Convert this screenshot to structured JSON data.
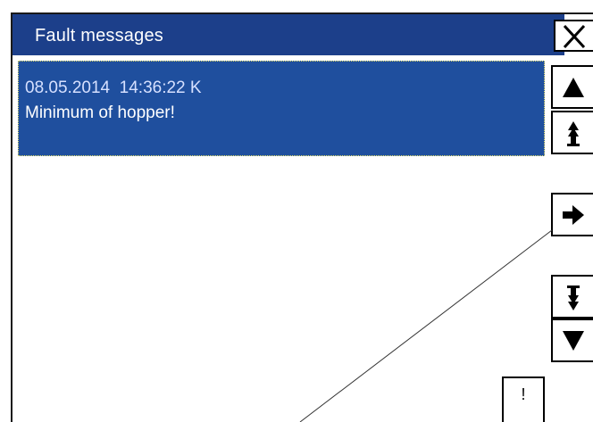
{
  "window": {
    "title": "Fault messages",
    "close_icon": "close-x-icon"
  },
  "messages": [
    {
      "date": "08.05.2014",
      "time": "14:36:22",
      "status": "K",
      "text": "Minimum of hopper!"
    }
  ],
  "side_buttons": [
    {
      "icon": "arrow-up-icon",
      "action": "previous message"
    },
    {
      "icon": "page-up-icon",
      "action": "first message"
    },
    {
      "icon": "arrow-right-icon",
      "action": "show details"
    },
    {
      "icon": "page-down-icon",
      "action": "last message"
    },
    {
      "icon": "arrow-down-icon",
      "action": "next message"
    }
  ],
  "acknowledge": {
    "label": "!"
  },
  "colors": {
    "titlebar": "#1c3f8a",
    "selection": "#1f4f9e",
    "selection_outline": "#f2e86b",
    "header_text": "#d6e0ff",
    "background": "#ffffff"
  }
}
